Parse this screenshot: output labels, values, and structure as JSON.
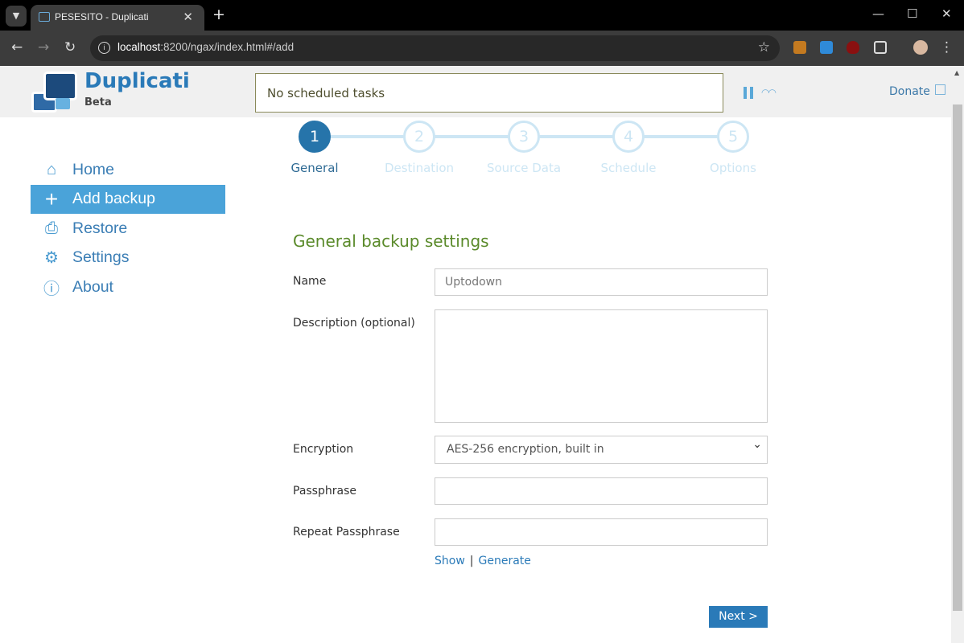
{
  "browser": {
    "tab_title": "PESESITO - Duplicati",
    "url_host": "localhost",
    "url_rest": ":8200/ngax/index.html#/add"
  },
  "header": {
    "brand": "Duplicati",
    "edition": "Beta",
    "status": "No scheduled tasks",
    "donate": "Donate"
  },
  "sidebar": {
    "items": [
      {
        "label": "Home",
        "icon": "home-icon"
      },
      {
        "label": "Add backup",
        "icon": "plus-icon"
      },
      {
        "label": "Restore",
        "icon": "restore-icon"
      },
      {
        "label": "Settings",
        "icon": "gear-icon"
      },
      {
        "label": "About",
        "icon": "info-icon"
      }
    ],
    "active": "Add backup"
  },
  "steps": [
    {
      "num": "1",
      "label": "General"
    },
    {
      "num": "2",
      "label": "Destination"
    },
    {
      "num": "3",
      "label": "Source Data"
    },
    {
      "num": "4",
      "label": "Schedule"
    },
    {
      "num": "5",
      "label": "Options"
    }
  ],
  "form": {
    "title": "General backup settings",
    "name_label": "Name",
    "name_value": "Uptodown",
    "desc_label": "Description (optional)",
    "desc_value": "",
    "enc_label": "Encryption",
    "enc_value": "AES-256 encryption, built in",
    "pass_label": "Passphrase",
    "repeat_label": "Repeat Passphrase",
    "show": "Show",
    "generate": "Generate",
    "next": "Next >"
  },
  "colors": {
    "accent": "#2a7ab8",
    "active_nav": "#4aa3d9",
    "title_green": "#5a8a2a"
  }
}
